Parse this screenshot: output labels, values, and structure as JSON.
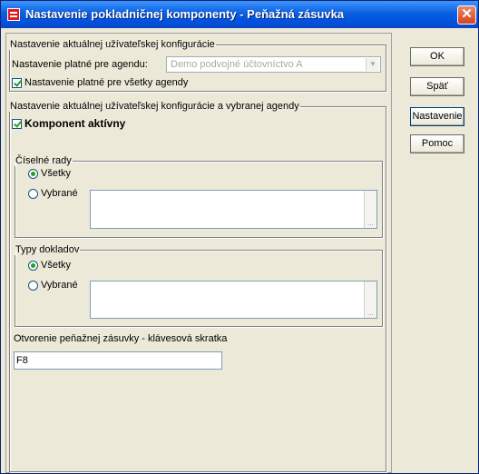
{
  "window": {
    "title": "Nastavenie pokladničnej komponenty - Peňažná zásuvka",
    "close_glyph": "✕"
  },
  "buttons": {
    "ok": "OK",
    "back": "Späť",
    "settings": "Nastavenie",
    "help": "Pomoc"
  },
  "user_config": {
    "legend": "Nastavenie aktuálnej užívateľskej konfigurácie",
    "agenda_label": "Nastavenie platné pre agendu:",
    "agenda_value": "Demo podvojné účtovníctvo A",
    "all_agendas_label": "Nastavenie platné pre všetky agendy",
    "all_agendas_checked": true
  },
  "agenda_config": {
    "legend": "Nastavenie aktuálnej užívateľskej konfigurácie a vybranej agendy",
    "component_active_label": "Komponent aktívny",
    "component_active_checked": true,
    "number_series": {
      "legend": "Číselné rady",
      "all_label": "Všetky",
      "selected_label": "Vybrané",
      "selection": "all"
    },
    "document_types": {
      "legend": "Typy dokladov",
      "all_label": "Všetky",
      "selected_label": "Vybrané",
      "selection": "all"
    },
    "shortcut_label": "Otvorenie peňažnej zásuvky - klávesová skratka",
    "shortcut_value": "F8"
  }
}
